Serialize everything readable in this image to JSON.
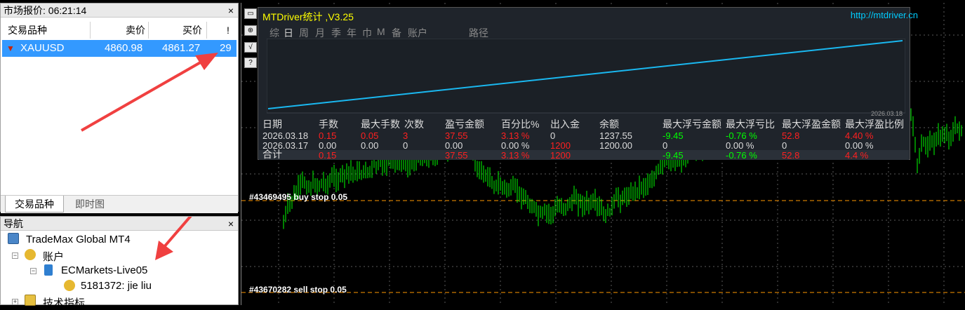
{
  "market_watch": {
    "title": "市场报价: 06:21:14",
    "close": "×",
    "columns": [
      "交易品种",
      "卖价",
      "买价",
      "!"
    ],
    "row": {
      "symbol": "XAUUSD",
      "bid": "4860.98",
      "ask": "4861.27",
      "spread": "29"
    },
    "tabs": [
      "交易品种",
      "即时图"
    ]
  },
  "navigator": {
    "title": "导航",
    "close": "×",
    "broker": "TradeMax Global MT4",
    "accounts_label": "账户",
    "server": "ECMarkets-Live05",
    "account": "5181372: jie liu",
    "indicators_label": "技术指标"
  },
  "indicator": {
    "title": "MTDriver统计 ,V3.25",
    "url": "http://mtdriver.cn",
    "nav": [
      "综",
      "日",
      "周",
      "月",
      "季",
      "年",
      "巾",
      "M",
      "备",
      "账户",
      "路径"
    ],
    "date_label": "2026.03.18",
    "equity_curve": [
      0,
      1
    ],
    "headers": [
      "日期",
      "手数",
      "最大手数",
      "次数",
      "盈亏金额",
      "百分比%",
      "出入金",
      "余额",
      "最大浮亏金额",
      "最大浮亏比",
      "最大浮盈金额",
      "最大浮盈比例"
    ],
    "rows": [
      [
        "2026.03.18",
        "0.15",
        "0.05",
        "3",
        "37.55",
        "3.13 %",
        "0",
        "1237.55",
        "-9.45",
        "-0.76 %",
        "52.8",
        "4.40 %"
      ],
      [
        "2026.03.17",
        "0.00",
        "0.00",
        "0",
        "0.00",
        "0.00 %",
        "1200",
        "1200.00",
        "0",
        "0.00 %",
        "0",
        "0.00 %"
      ]
    ],
    "total": [
      "合计",
      "0.15",
      "37.55",
      "3.13 %",
      "1200",
      "-9.45",
      "-0.76 %",
      "52.8",
      "4.4 %"
    ]
  },
  "orders": [
    {
      "label": "#43469495 buy stop 0.05"
    },
    {
      "label": "#43670282 sell stop 0.05"
    }
  ],
  "colors": {
    "bull": "#00ff00",
    "stop_line": "#ff9900",
    "highlight": "#3399ff",
    "positive_red": "#ff0000",
    "negative_green": "#00ff00"
  }
}
